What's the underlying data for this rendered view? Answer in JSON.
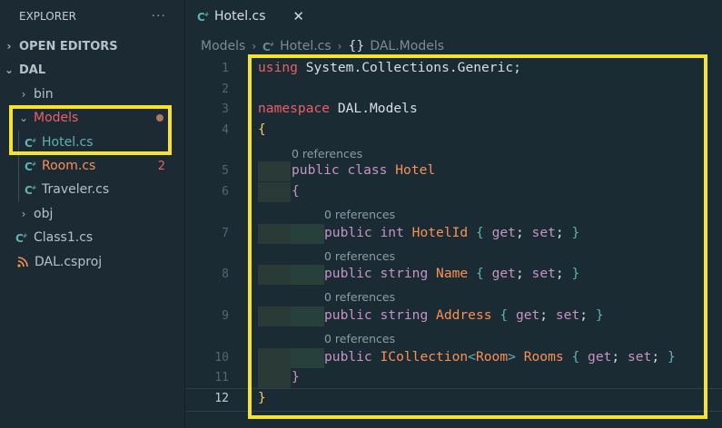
{
  "explorer": {
    "title": "EXPLORER",
    "more": "···",
    "open_editors": "OPEN EDITORS",
    "project": "DAL",
    "items": [
      {
        "label": "bin",
        "kind": "folder"
      },
      {
        "label": "Models",
        "kind": "folder-open"
      },
      {
        "label": "Hotel.cs",
        "kind": "cs"
      },
      {
        "label": "Room.cs",
        "kind": "cs",
        "badge": "2"
      },
      {
        "label": "Traveler.cs",
        "kind": "cs"
      },
      {
        "label": "obj",
        "kind": "folder"
      },
      {
        "label": "Class1.cs",
        "kind": "cs"
      },
      {
        "label": "DAL.csproj",
        "kind": "rss"
      }
    ]
  },
  "tab": {
    "label": "Hotel.cs",
    "close": "✕"
  },
  "breadcrumb": {
    "a": "Models",
    "b": "Hotel.cs",
    "braces": "{}",
    "c": "DAL.Models"
  },
  "editor": {
    "line_numbers": [
      "1",
      "2",
      "3",
      "4",
      "5",
      "6",
      "7",
      "8",
      "9",
      "10",
      "11",
      "12"
    ],
    "lens": "0 references",
    "l1_kw": "using",
    "l1_rest": " System.Collections.Generic;",
    "l3_kw": "namespace",
    "l3_rest": " DAL.Models",
    "open_brace": "{",
    "close_brace": "}",
    "l5_pub": "public",
    "l5_class": "class",
    "l5_name": "Hotel",
    "p1_type": "int",
    "p1_name": "HotelId",
    "p2_type": "string",
    "p2_name": "Name",
    "p3_type": "string",
    "p3_name": "Address",
    "p4_type": "ICollection",
    "p4_generic": "Room",
    "p4_name": "Rooms",
    "get": "get",
    "set": "set"
  },
  "colors": {
    "highlight": "#f7e42a",
    "background": "#1b2b34",
    "keyword": "#c594c5",
    "type": "#f99157"
  }
}
